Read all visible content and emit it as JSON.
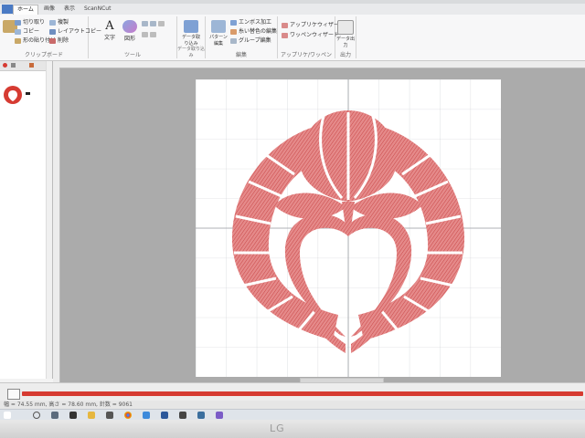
{
  "tabs": [
    "ホーム",
    "画像",
    "表示",
    "ScanNCut"
  ],
  "ribbon": {
    "clipboard": {
      "label": "クリップボード",
      "items": [
        "切り取り",
        "コピー",
        "形の貼り付け",
        "複製",
        "レイアウトコピー",
        "削除"
      ]
    },
    "tools": {
      "label": "ツール",
      "text_label": "文字",
      "shape_label": "図形"
    },
    "data": {
      "label": "データ取り込み",
      "button": "データ取り込み"
    },
    "edit": {
      "label": "編集",
      "pattern_label": "パターン編集",
      "items": [
        "エンボス加工",
        "糸い替色の編集",
        "グループ編集"
      ]
    },
    "applique": {
      "label": "アップリケ/ワッペン",
      "items": [
        "アップリケウィザード",
        "ワッペンウィザード"
      ]
    },
    "output": {
      "label": "出力",
      "button": "データ出力"
    }
  },
  "status": {
    "text": "幅 = 74.55 mm, 高さ = 78.60 mm, 針数 = 9061"
  },
  "colors": {
    "accent": "#d63b32",
    "stitch": "#df6a6a"
  }
}
